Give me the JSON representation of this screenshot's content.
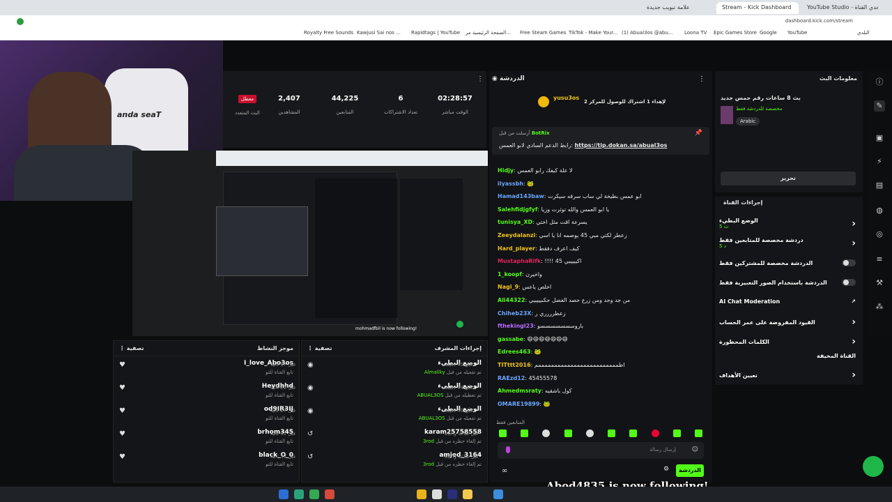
{
  "browser": {
    "tabs": [
      {
        "label": "علامة تبويب جديدة",
        "active": false
      },
      {
        "label": "Stream - Kick Dashboard",
        "active": true
      },
      {
        "label": "YouTube Studio - يحدي القناة",
        "active": false
      }
    ],
    "url": "dashboard.kick.com/stream",
    "bookmarks": [
      "Royalty Free Sounds",
      "Kawjusi Sai nos ...",
      "Rapidtags | YouTube",
      "الصفحة الرئيسية مر...",
      "Free Steam Games",
      "TikTok - Make Your...",
      "(1) AbuaI3os @abu...",
      "Loona TV",
      "Epic Games Store",
      "Google",
      "YouTube",
      "البلدي"
    ]
  },
  "stats": {
    "live_badge": "معطل",
    "live_label": "البث المتعدد",
    "viewers_value": "2,407",
    "viewers_label": "المشاهدين",
    "followers_value": "44,225",
    "followers_label": "المتابعين",
    "subs_value": "6",
    "subs_label": "تعداد الاشتراكات",
    "time_value": "02:28:57",
    "time_label": "الوقت مباشر"
  },
  "activity": {
    "title": "موجز النشاط",
    "filter": "تصفية",
    "rows": [
      {
        "name": "I_love_Abo3os",
        "sub": "تابع القناة للتو",
        "time": "قبل 17 ثانية"
      },
      {
        "name": "Heydhhd",
        "sub": "تابع القناة للتو",
        "time": "قبل 22 ثانية"
      },
      {
        "name": "od9IR3IJ",
        "sub": "تابع القناة للتو",
        "time": "قبل 27 ثانية"
      },
      {
        "name": "brhom345",
        "sub": "تابع القناة للتو",
        "time": "قبل 31 ثانية"
      },
      {
        "name": "black_O_0",
        "sub": "تابع القناة للتو",
        "time": "قبل 33 ثانية"
      }
    ]
  },
  "mod_actions": {
    "title": "إجراءات المشرف",
    "filter": "تصفية",
    "rows": [
      {
        "name": "الوضع البطيء",
        "sub": "تم تفعيله من قبل",
        "by": "Almaliky",
        "time": "قبل 41 دقيقة"
      },
      {
        "name": "الوضع البطيء",
        "sub": "تم تعطيله من قبل",
        "by": "ABUAL3OS",
        "time": "قبل 44 دقيقة"
      },
      {
        "name": "الوضع البطيء",
        "sub": "تم تفعيله من قبل",
        "by": "ABUAL3OS",
        "time": "قبل 50 دقيقة"
      },
      {
        "name": "karam25758558",
        "sub": "تم إلغاء حظره من قبل",
        "by": "3rod",
        "time": "قبل ساعة واحدة"
      },
      {
        "name": "amjed_3164",
        "sub": "تم إلغاء حظره من قبل",
        "by": "3rod",
        "time": "قبل ساعة واحدة"
      }
    ]
  },
  "chat": {
    "title": "الدردشة",
    "pinned_user": "yusu3os",
    "pinned_text": "لإهداء 1 اشتراك للوصول للمركز 2",
    "bot_name": "BotRix",
    "bot_prefix": "أرسلت من قبل",
    "bot_text": "رابط الدعم السادي لابو العمس:",
    "bot_link": "https://tip.dokan.sa/abual3os",
    "messages": [
      {
        "user": "Hidjy",
        "text": "لا علة كيفك رابو العمس",
        "color": "#53fc18"
      },
      {
        "user": "ilyassbh",
        "text": "🐸",
        "color": "#6aa6ff"
      },
      {
        "user": "Hamad143baw",
        "text": "ابو عمس بطيخة لي ساب سرقه سيكرت",
        "color": "#6aa6ff"
      },
      {
        "user": "Salehfidjgfyf",
        "text": "يا ابو العمس والله توثرت وزيا",
        "color": "#53fc18"
      },
      {
        "user": "tunisya_XD",
        "text": "يسرعة اقت مثل اختي",
        "color": "#53fc18"
      },
      {
        "user": "Zeeydalanzi",
        "text": "زعطر لكتي مبي 45 يوصمه انا يا اسي",
        "color": "#f0c419"
      },
      {
        "user": "Hard_player",
        "text": "كيف اعرف دفقط",
        "color": "#f0c419"
      },
      {
        "user": "MustaphaRifk",
        "text": "!!!! 45 اكيييييي",
        "color": "#e0245e"
      },
      {
        "user": "1_koopf",
        "text": "واخيرن",
        "color": "#53fc18"
      },
      {
        "user": "Nagi_9",
        "text": "اخلص ياعس",
        "color": "#f0c419"
      },
      {
        "user": "Ali44322",
        "text": "من جد وجد ومن زرع حصد الفضل حكىيييييي",
        "color": "#53fc18"
      },
      {
        "user": "Chiheb23X",
        "text": "زعطرررري ر",
        "color": "#6aa6ff"
      },
      {
        "user": "fthekingl23",
        "text": "باروسسسسسسسو",
        "color": "#b86bff"
      },
      {
        "user": "gassabe",
        "text": "😄😄😄😄😄😄😄",
        "color": "#53fc18"
      },
      {
        "user": "Edrees463",
        "text": "🐸",
        "color": "#53fc18"
      },
      {
        "user": "TITttt2016",
        "text": "اطمممممممممممممممممممممممممم",
        "color": "#f0c419"
      },
      {
        "user": "RAEzd12",
        "text": "45455578",
        "color": "#6aa6ff"
      },
      {
        "user": "Ahmedmsraty",
        "text": "كول باشقيه",
        "color": "#53fc18"
      },
      {
        "user": "OMARE19899",
        "text": "🐸",
        "color": "#6aa6ff"
      }
    ],
    "emote_label": "المتابعين فقط",
    "input_placeholder": "إرسال رسالة",
    "send_label": "الدردشة"
  },
  "stream_info": {
    "title": "معلومات البث",
    "stream_title": "بث 8 ساعات رقم حمس جديد",
    "subtitle": "مخصصة للدردشة فقط",
    "tag": "Arabic",
    "edit_label": "تحرير"
  },
  "channel_actions": {
    "title": "إجراءات القناة",
    "items": [
      {
        "label": "الوضع البطيء",
        "sub": "5 ث",
        "control": "chevron"
      },
      {
        "label": "دردشة مخصصة للمتابعين فقط",
        "sub": "5 د",
        "control": "chevron"
      },
      {
        "label": "الدردشة مخصصة للمشتركين فقط",
        "control": "toggle"
      },
      {
        "label": "الدردشة باستخدام الصور التعبيرية فقط",
        "control": "toggle"
      },
      {
        "label": "AI Chat Moderation",
        "control": "link"
      },
      {
        "label": "القيود المفروضة على عمر الحساب",
        "control": "chevron"
      },
      {
        "label": "الكلمات المحظورة",
        "control": "chevron"
      },
      {
        "label": "القناة المخيفة",
        "control": "none"
      },
      {
        "label": "تعيين الأهداف",
        "control": "chevron"
      }
    ]
  },
  "overlay": {
    "follow_alert": "Abod4835 is now following!"
  },
  "video": {
    "follow_text": "mohmadfbil is now following!"
  },
  "webcam": {
    "chair_brand": "anda seaT"
  },
  "colors": {
    "accent": "#53fc18",
    "panel": "#141518",
    "bg": "#0c0d0e"
  }
}
